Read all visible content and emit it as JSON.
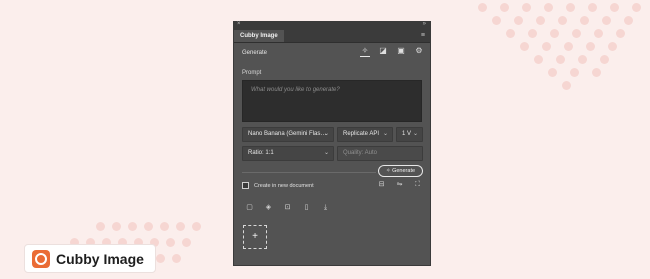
{
  "colors": {
    "background": "#fbeeec",
    "panel": "#535353",
    "dots": "#f6d6d2",
    "brand": "#ea6c35"
  },
  "window": {
    "close_glyph": "×",
    "collapse_glyph": "»"
  },
  "panel": {
    "tab_title": "Cubby Image",
    "menu_icon": "hamburger-icon",
    "section_title": "Generate",
    "header_icons": [
      "magic-wand-icon",
      "edit-image-icon",
      "image-icon",
      "settings-gear-icon"
    ],
    "prompt_label": "Prompt",
    "prompt_placeholder": "What would you like to generate?",
    "model_select": "Nano Banana (Gemini Flas…",
    "api_select": "Replicate API",
    "count_select": "1 V",
    "ratio_select": "Ratio: 1:1",
    "quality_select": "Quality: Auto",
    "generate_button": "Generate",
    "new_document_label": "Create in new document",
    "new_document_checked": false,
    "document_icons": [
      "layers-icon",
      "adjust-icon",
      "expand-icon"
    ],
    "tool_icons": [
      "copy-icon",
      "layers-stack-icon",
      "place-image-icon",
      "delete-icon",
      "download-icon"
    ],
    "add_slot": "+"
  },
  "brand": {
    "name": "Cubby Image"
  }
}
